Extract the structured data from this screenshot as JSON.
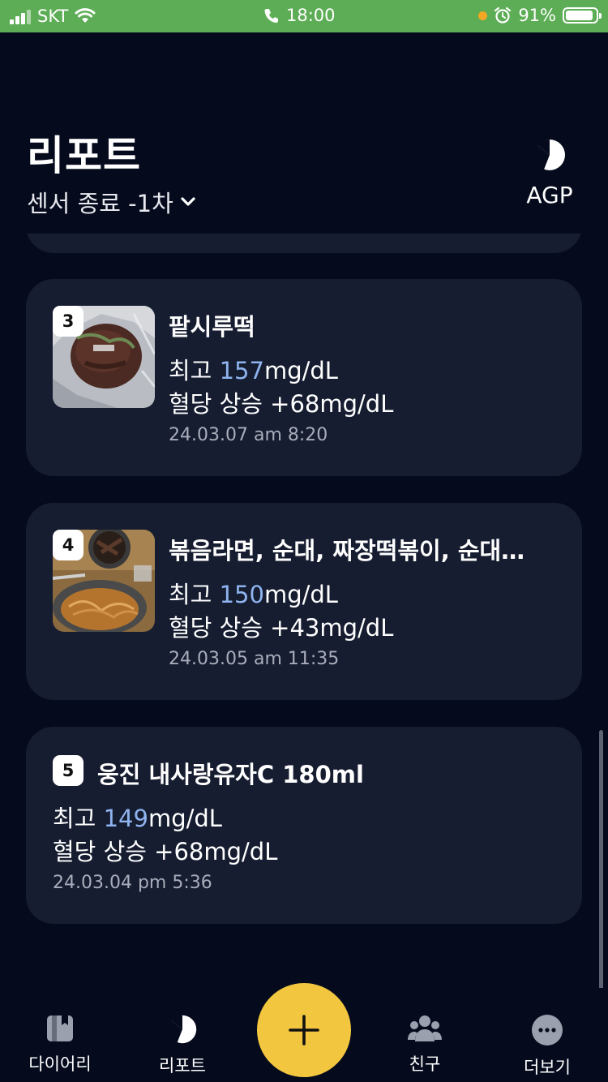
{
  "status_bar": {
    "carrier": "SKT",
    "time": "18:00",
    "battery": "91%",
    "battery_level": 0.91
  },
  "header": {
    "title": "리포트",
    "sensor_label": "센서 종료 -1차",
    "agp_label": "AGP"
  },
  "cards": [
    {
      "index": "3",
      "name": "팥시루떡",
      "peak_prefix": "최고 ",
      "peak_value": "157",
      "peak_unit": "mg/dL",
      "rise": "혈당 상승 +68mg/dL",
      "datetime": "24.03.07 am 8:20"
    },
    {
      "index": "4",
      "name": "볶음라면, 순대, 짜장떡볶이, 순대…",
      "peak_prefix": "최고 ",
      "peak_value": "150",
      "peak_unit": "mg/dL",
      "rise": "혈당 상승 +43mg/dL",
      "datetime": "24.03.05 am 11:35"
    },
    {
      "index": "5",
      "name": "웅진 내사랑유자C 180ml",
      "peak_prefix": "최고 ",
      "peak_value": "149",
      "peak_unit": "mg/dL",
      "rise": "혈당 상승 +68mg/dL",
      "datetime": "24.03.04 pm 5:36"
    }
  ],
  "tabs": [
    {
      "label": "다이어리",
      "icon": "diary-icon"
    },
    {
      "label": "리포트",
      "icon": "report-icon"
    },
    {
      "label": "친구",
      "icon": "friends-icon"
    },
    {
      "label": "더보기",
      "icon": "more-icon"
    }
  ],
  "fab_icon": "plus-icon",
  "colors": {
    "background": "#050b1d",
    "card": "#161d30",
    "accent_value": "#8fb4f0",
    "fab": "#f3c63f",
    "status_bar": "#5cad55"
  }
}
